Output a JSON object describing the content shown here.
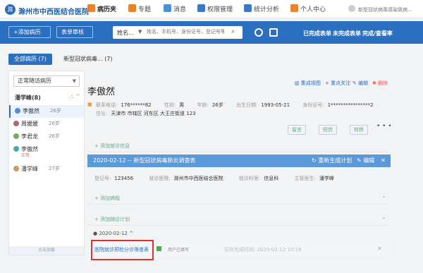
{
  "app": {
    "logo_char": "滁",
    "hospital": "滁州市中西医结合医院",
    "alert": "新型冠状病毒感染致病..."
  },
  "nav": [
    {
      "label": "病历夹",
      "color": "#e8832a",
      "active": true
    },
    {
      "label": "专题",
      "color": "#e8832a",
      "active": false
    },
    {
      "label": "消息",
      "color": "#4a90d9",
      "active": false
    },
    {
      "label": "权限管理",
      "color": "#3a78c8",
      "active": false
    },
    {
      "label": "统计分析",
      "color": "#3a78c8",
      "active": false
    },
    {
      "label": "个人中心",
      "color": "#e8832a",
      "active": false
    }
  ],
  "toolbar": {
    "add_record": "+添加病历",
    "form_review": "表单审核",
    "search_select": "姓名...",
    "search_placeholder": "姓名、手机号、身份证号、登记号等",
    "completed": "已完成表单",
    "incomplete": "未完成表单",
    "finished": "完成/查看率"
  },
  "tabs": [
    {
      "label": "全部病历",
      "count": "(7)"
    },
    {
      "label": "新型冠状病毒...",
      "count": "(7)"
    }
  ],
  "filter": {
    "value": "正常随访病历"
  },
  "group": {
    "label": "潘学峰(8)"
  },
  "patients": [
    {
      "name": "李傲然",
      "age": "26岁",
      "sub": ""
    },
    {
      "name": "周媛媛",
      "age": "26岁",
      "sub": ""
    },
    {
      "name": "李君龙",
      "age": "26岁",
      "sub": ""
    },
    {
      "name": "李傲然",
      "age": "26岁",
      "sub": "正常"
    },
    {
      "name": "潘学峰",
      "age": "27岁",
      "sub": ""
    }
  ],
  "loadmore": "点击加载",
  "patient": {
    "name": "李傲然",
    "actions": {
      "view": "集成视图",
      "focus": "+ 重点关注",
      "edit": "编辑",
      "delete": "删除"
    },
    "phone_label": "联系电话:",
    "phone": "176******82",
    "gender_label": "性别:",
    "gender": "男",
    "age_label": "年龄:",
    "age": "26岁",
    "birth_label": "出生日期:",
    "birth": "1993-05-21",
    "id_label": "身份证号:",
    "id": "1****************2",
    "addr_label": "住址:",
    "addr": "天津市 市辖区 河东区 大王庄街道 123"
  },
  "buttons": {
    "leave_msg": "留言",
    "sms": "短信",
    "transfer": "转移"
  },
  "add_diag": "+ 添加就诊信息",
  "bluebar": {
    "text": "2020-02-12  --  新型冠状病毒肺炎调查表",
    "regen": "重新生成计划",
    "edit": "编辑",
    "close": "✕"
  },
  "detail": {
    "reg_label": "登记号:",
    "reg": "123456",
    "hosp_label": "就诊医院:",
    "hosp": "滁州市中西医结合医院",
    "dept_label": "就诊科室:",
    "dept": "信息科",
    "doc_label": "主管医生:",
    "doc": "潘学峰"
  },
  "add_history": "+ 添加病程",
  "add_plan": "+ 添加随访计划",
  "visit": {
    "date": "● 2020-02-12  ^",
    "link": "医院就诊预检分诊筛查表",
    "status": "用户已填写",
    "time": "实际完成时间:  2020-02-12 10:16",
    "close": "✕"
  }
}
